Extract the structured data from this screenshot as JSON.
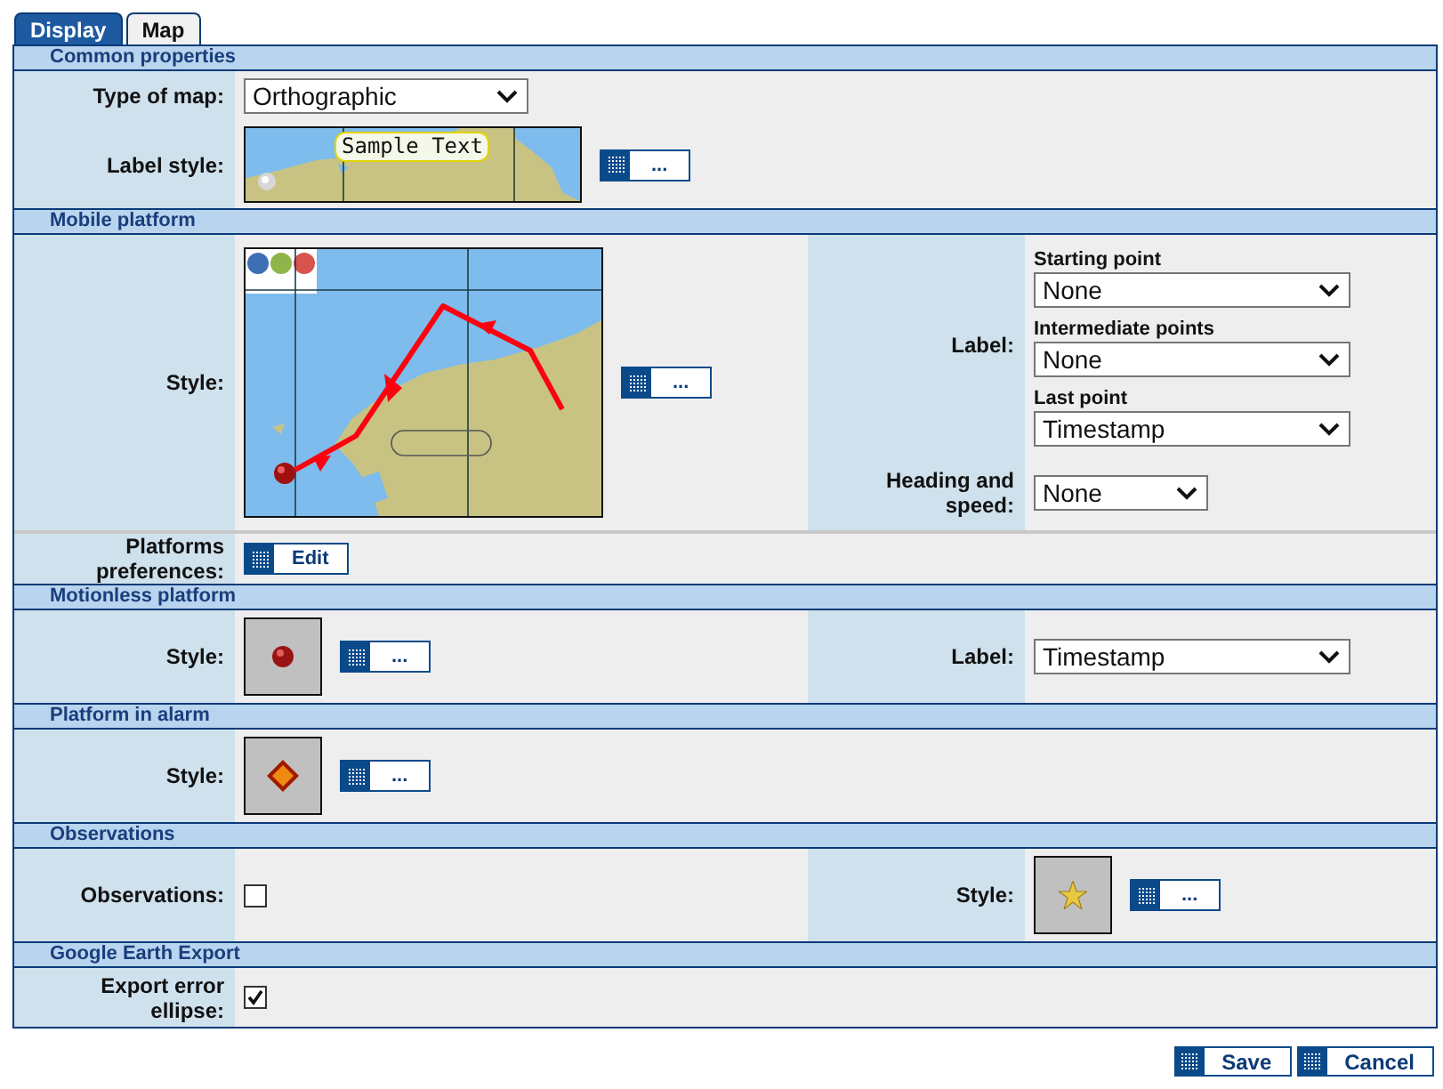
{
  "tabs": [
    {
      "label": "Display",
      "selected": true
    },
    {
      "label": "Map",
      "selected": false
    }
  ],
  "sections": [
    {
      "title": "Common properties",
      "rows": [
        {
          "left": [
            {
              "kind": "select",
              "label": "Type of map:",
              "value": "Orthographic"
            }
          ]
        },
        {
          "left": [
            {
              "kind": "style",
              "label": "Label style:",
              "preview": {
                "kind": "label-map"
              },
              "sample": "Sample Text",
              "button": "..."
            }
          ]
        }
      ]
    },
    {
      "title": "Mobile platform",
      "rows": [
        {
          "left": [
            {
              "kind": "style",
              "label": "Style:",
              "preview": {
                "kind": "track-map"
              },
              "button": "..."
            }
          ],
          "right": [
            {
              "kind": "select-group",
              "label": "Label:",
              "selects": [
                {
                  "caption": "Starting point",
                  "value": "None"
                },
                {
                  "caption": "Intermediate points",
                  "value": "None"
                },
                {
                  "caption": "Last point",
                  "value": "Timestamp"
                }
              ]
            },
            {
              "kind": "short-select",
              "label": "Heading and speed:",
              "value": "None"
            }
          ]
        },
        {
          "left": [
            {
              "kind": "edit",
              "label": "Platforms preferences:",
              "button": "Edit"
            }
          ]
        }
      ]
    },
    {
      "title": "Motionless platform",
      "rows": [
        {
          "left": [
            {
              "kind": "style",
              "label": "Style:",
              "preview": {
                "kind": "ball"
              },
              "button": "..."
            }
          ],
          "right": [
            {
              "kind": "wide-select",
              "label": "Label:",
              "value": "Timestamp"
            }
          ]
        }
      ]
    },
    {
      "title": "Platform in alarm",
      "rows": [
        {
          "left": [
            {
              "kind": "style",
              "label": "Style:",
              "preview": {
                "kind": "diamond"
              },
              "button": "..."
            }
          ]
        }
      ]
    },
    {
      "title": "Observations",
      "rows": [
        {
          "left": [
            {
              "kind": "checkbox",
              "label": "Observations:",
              "checked": false
            }
          ],
          "right": [
            {
              "kind": "style",
              "label": "Style:",
              "preview": {
                "kind": "star"
              },
              "button": "..."
            }
          ]
        }
      ]
    },
    {
      "title": "Google Earth Export",
      "rows": [
        {
          "left": [
            {
              "kind": "checkbox",
              "label": "Export error ellipse:",
              "checked": true
            }
          ]
        }
      ]
    }
  ],
  "footer": [
    {
      "label": "Save"
    },
    {
      "label": "Cancel"
    }
  ]
}
